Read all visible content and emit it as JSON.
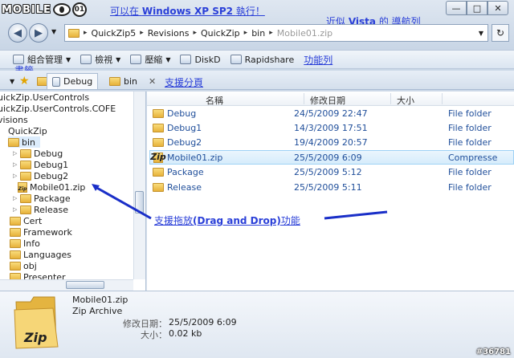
{
  "branding": {
    "logo_text": "MOBILE",
    "logo_badge": "01"
  },
  "annotations": {
    "top_note_prefix": "可以在",
    "top_note_bold": "Windows XP SP2",
    "top_note_suffix": "執行！",
    "vista_prefix": "近似",
    "vista_bold": "Vista",
    "vista_suffix": "的 導航列",
    "toolbar_note": "功能列",
    "bookmark_note": "書籤",
    "tabs_note": "支援分頁",
    "dnd_prefix": "支援拖放",
    "dnd_bold": "(Drag and Drop)",
    "dnd_suffix": "功能",
    "arrow_color": "#1a2fc8"
  },
  "window": {
    "minimize": "—",
    "maximize": "□",
    "close": "✕"
  },
  "address": {
    "crumbs": [
      "QuickZip5",
      "Revisions",
      "QuickZip",
      "bin"
    ],
    "current": "Mobile01.zip",
    "separator": "▸"
  },
  "toolbar": {
    "items": [
      {
        "label": "組合管理",
        "has_caret": true,
        "icon": "organize-icon"
      },
      {
        "label": "檢視",
        "has_caret": true,
        "icon": "views-icon"
      },
      {
        "label": "壓縮",
        "has_caret": true,
        "icon": "compress-icon"
      },
      {
        "label": "DiskD",
        "has_caret": false,
        "icon": "disk-icon"
      },
      {
        "label": "Rapidshare",
        "has_caret": false,
        "icon": "rapidshare-icon"
      }
    ]
  },
  "tabs": [
    {
      "label": "Debug",
      "active": true
    },
    {
      "label": "bin",
      "active": false
    }
  ],
  "tree": [
    {
      "label": "uickZip.UserControls",
      "indent": 0,
      "icon": "none"
    },
    {
      "label": "uickZip.UserControls.COFE",
      "indent": 0,
      "icon": "none"
    },
    {
      "label": "visions",
      "indent": 0,
      "icon": "none"
    },
    {
      "label": "QuickZip",
      "indent": 1,
      "icon": "none"
    },
    {
      "label": "bin",
      "indent": 2,
      "icon": "folder",
      "selected": true
    },
    {
      "label": "Debug",
      "indent": 3,
      "icon": "folder",
      "expander": "▷"
    },
    {
      "label": "Debug1",
      "indent": 3,
      "icon": "folder",
      "expander": "▷"
    },
    {
      "label": "Debug2",
      "indent": 3,
      "icon": "folder",
      "expander": "▷"
    },
    {
      "label": "Mobile01.zip",
      "indent": 3,
      "icon": "zip"
    },
    {
      "label": "Package",
      "indent": 3,
      "icon": "folder",
      "expander": "▷"
    },
    {
      "label": "Release",
      "indent": 3,
      "icon": "folder",
      "expander": "▷"
    },
    {
      "label": "Cert",
      "indent": 1,
      "icon": "folder"
    },
    {
      "label": "Framework",
      "indent": 1,
      "icon": "folder"
    },
    {
      "label": "Info",
      "indent": 1,
      "icon": "folder"
    },
    {
      "label": "Languages",
      "indent": 1,
      "icon": "folder"
    },
    {
      "label": "obj",
      "indent": 1,
      "icon": "folder"
    },
    {
      "label": "Presenter",
      "indent": 1,
      "icon": "folder"
    }
  ],
  "columns": {
    "name": "名稱",
    "modified": "修改日期",
    "size": "大小"
  },
  "files": [
    {
      "name": "Debug",
      "date": "24/5/2009 22:47",
      "type": "File folder",
      "icon": "folder"
    },
    {
      "name": "Debug1",
      "date": "14/3/2009 17:51",
      "type": "File folder",
      "icon": "folder"
    },
    {
      "name": "Debug2",
      "date": "19/4/2009 20:57",
      "type": "File folder",
      "icon": "folder"
    },
    {
      "name": "Mobile01.zip",
      "date": "25/5/2009 6:09",
      "type": "Compresse",
      "icon": "zip",
      "selected": true
    },
    {
      "name": "Package",
      "date": "25/5/2009 5:12",
      "type": "File folder",
      "icon": "folder"
    },
    {
      "name": "Release",
      "date": "25/5/2009 5:11",
      "type": "File folder",
      "icon": "folder"
    }
  ],
  "details": {
    "filename": "Mobile01.zip",
    "filetype": "Zip Archive",
    "modified_label": "修改日期：",
    "modified_value": "25/5/2009 6:09",
    "size_label": "大小：",
    "size_value": "0.02 kb",
    "icon_text": "Zip"
  },
  "watermark": "#36781"
}
